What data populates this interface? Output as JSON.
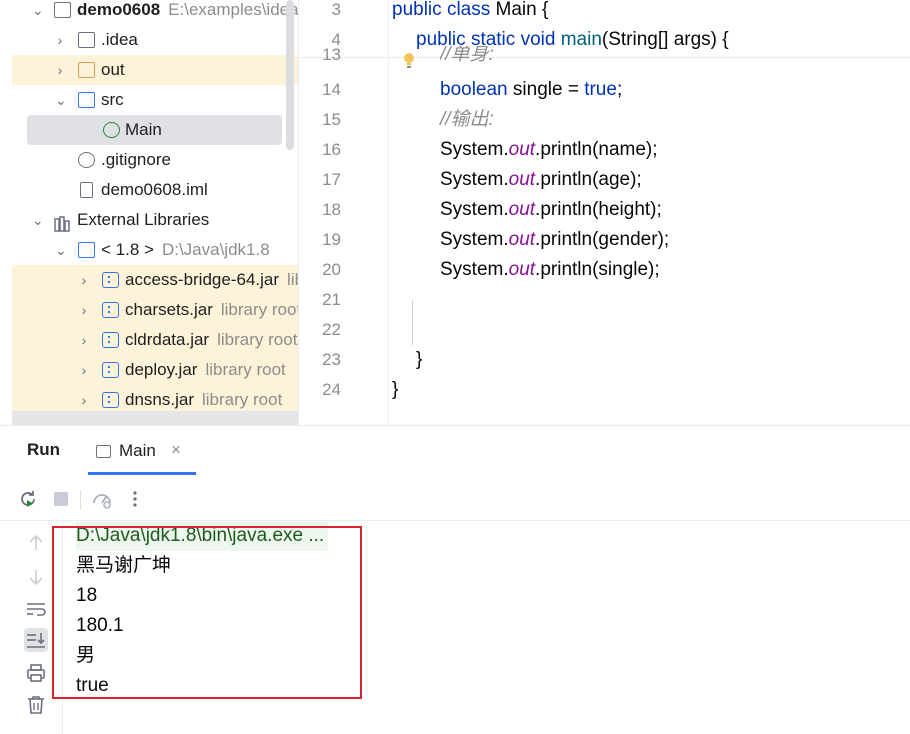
{
  "project_tree": {
    "items": [
      {
        "label": "demo0608",
        "hint": "E:\\examples\\idea"
      },
      {
        "label": ".idea"
      },
      {
        "label": "out"
      },
      {
        "label": "src"
      },
      {
        "label": "Main"
      },
      {
        "label": ".gitignore"
      },
      {
        "label": "demo0608.iml"
      },
      {
        "label": "External Libraries"
      },
      {
        "label": "< 1.8 >",
        "hint": "D:\\Java\\jdk1.8"
      },
      {
        "label": "access-bridge-64.jar",
        "hint": "lib"
      },
      {
        "label": "charsets.jar",
        "hint": "library root"
      },
      {
        "label": "cldrdata.jar",
        "hint": "library root"
      },
      {
        "label": "deploy.jar",
        "hint": "library root"
      },
      {
        "label": "dnsns.jar",
        "hint": "library root"
      }
    ]
  },
  "editor": {
    "lines": [
      {
        "num": "3"
      },
      {
        "num": "4"
      },
      {
        "num": "13"
      },
      {
        "num": "14"
      },
      {
        "num": "15"
      },
      {
        "num": "16"
      },
      {
        "num": "17"
      },
      {
        "num": "18"
      },
      {
        "num": "19"
      },
      {
        "num": "20"
      },
      {
        "num": "21"
      },
      {
        "num": "22"
      },
      {
        "num": "23"
      },
      {
        "num": "24"
      }
    ],
    "tokens": {
      "public": "public",
      "class": "class",
      "main_class": "Main",
      "brace_open": " {",
      "static": "static",
      "void": "void",
      "main_fn": "main",
      "params": "(String[] args) {",
      "comment_single": "//单身:",
      "boolean": "boolean",
      "single_decl": " single = ",
      "true": "true",
      "semicolon": ";",
      "comment_output": "//输出:",
      "system": "System.",
      "out": "out",
      "println_name": ".println(name);",
      "println_age": ".println(age);",
      "println_height": ".println(height);",
      "println_gender": ".println(gender);",
      "println_single": ".println(single);",
      "brace_close": "}"
    }
  },
  "run_window": {
    "title": "Run",
    "tab_label": "Main",
    "tab_close": "×",
    "output": [
      "D:\\Java\\jdk1.8\\bin\\java.exe ...",
      "黑马谢广坤",
      "18",
      "180.1",
      "男",
      "true"
    ],
    "highlight_color": "#d9232e"
  }
}
